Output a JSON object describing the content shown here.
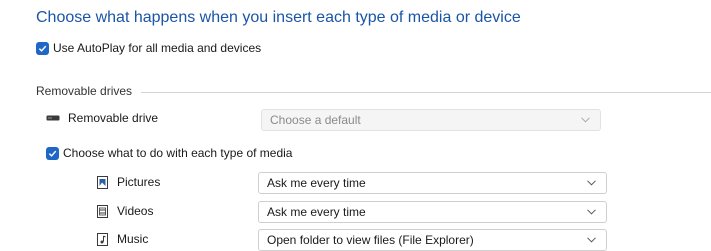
{
  "page": {
    "title": "Choose what happens when you insert each type of media or device",
    "autoplay_all": {
      "label": "Use AutoPlay for all media and devices",
      "checked": true
    }
  },
  "removable": {
    "group_label": "Removable drives",
    "drive": {
      "label": "Removable drive",
      "icon": "drive-icon",
      "value": "Choose a default",
      "disabled": true
    },
    "each_type": {
      "label": "Choose what to do with each type of media",
      "checked": true
    },
    "media": [
      {
        "label": "Pictures",
        "icon": "pictures-icon",
        "value": "Ask me every time"
      },
      {
        "label": "Videos",
        "icon": "videos-icon",
        "value": "Ask me every time"
      },
      {
        "label": "Music",
        "icon": "music-icon",
        "value": "Open folder to view files (File Explorer)"
      }
    ]
  },
  "colors": {
    "accent": "#1f66c6",
    "title": "#1a55a6"
  }
}
